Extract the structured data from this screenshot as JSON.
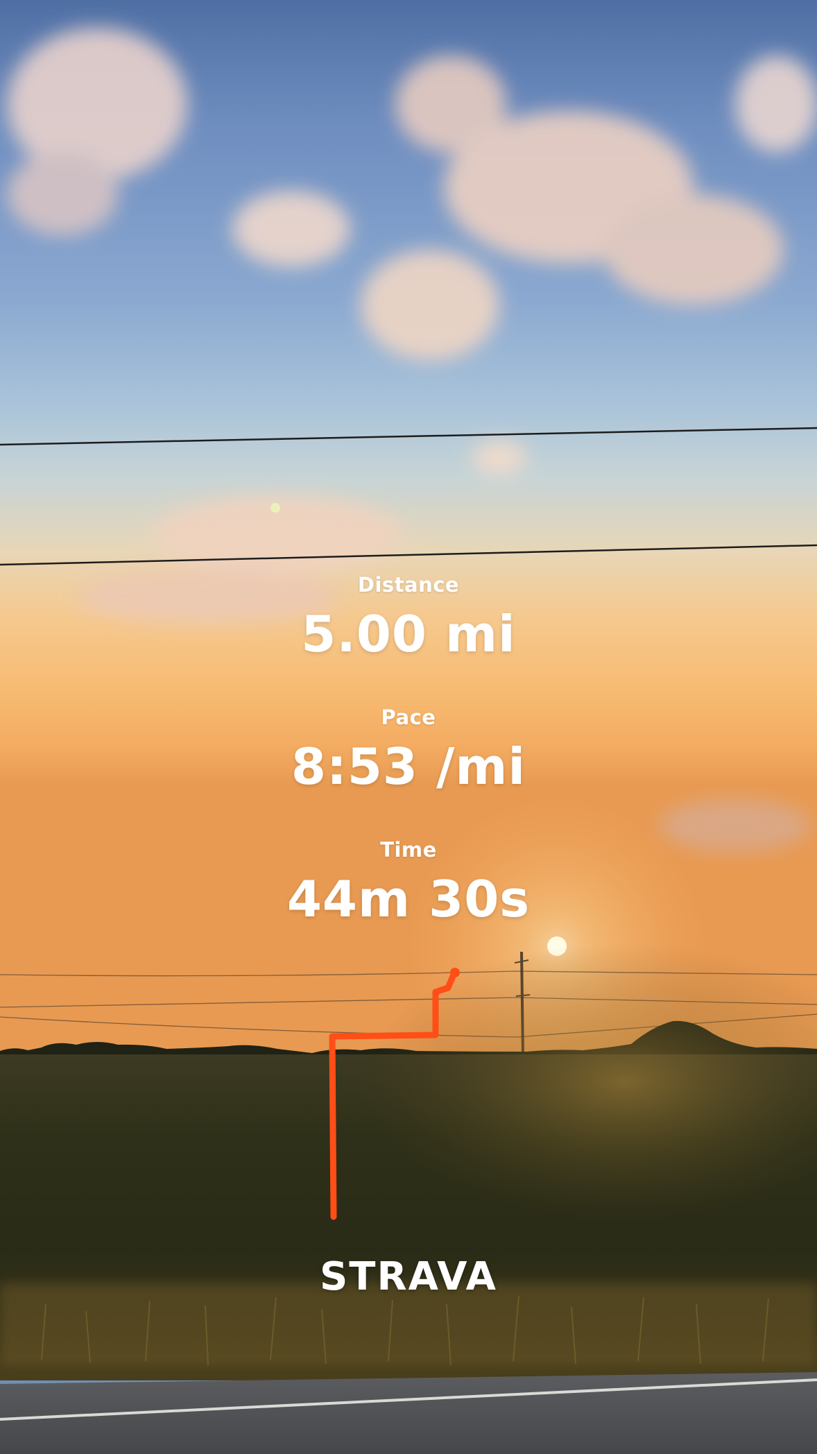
{
  "stats": {
    "distance": {
      "label": "Distance",
      "value": "5.00 mi"
    },
    "pace": {
      "label": "Pace",
      "value": "8:53 /mi"
    },
    "time": {
      "label": "Time",
      "value": "44m 30s"
    }
  },
  "brand": {
    "name": "STRAVA"
  },
  "colors": {
    "route": "#ff4e16",
    "text": "#ffffff"
  }
}
